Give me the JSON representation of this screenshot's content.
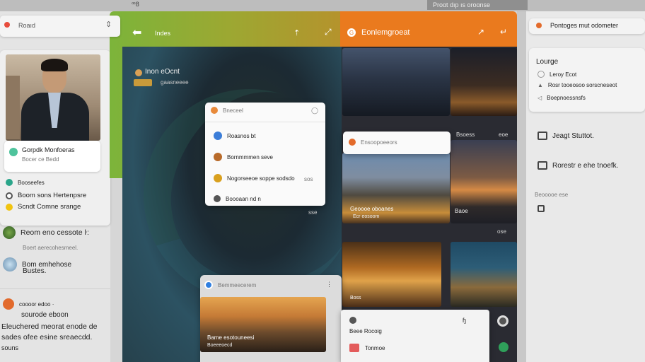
{
  "topbar": {
    "left_text": "ꟹ8",
    "right_text": "Proɑt dıp ıs oroɑnse"
  },
  "search": {
    "placeholder": "Roaıd"
  },
  "profile": {
    "name_line1": "Gorpdk Monfoeras",
    "name_line2": "Bocer ce Bedd",
    "items": [
      "Booseefes",
      "Boom sons Hertenpsre",
      "Scndt Comne srange"
    ]
  },
  "left_list": [
    {
      "title": "Reom eno cessote ŀ:",
      "sub": "Boert aerecohesmeel."
    },
    {
      "title": "Bom emhehose",
      "sub": "Bustes."
    },
    {
      "title": "coooor edoo ·",
      "sub": "sourode eboon"
    }
  ],
  "left_footer": [
    "Eleuchered meorat enode de",
    "sades ofee esine sreaecdd.",
    "souns"
  ],
  "green": {
    "title": "Indes",
    "sub_title": "Inon eOcnt",
    "sub_meta": "gaasneeee"
  },
  "orange": {
    "title": "Eonlemgroeat"
  },
  "popup_center": {
    "header": "Bneceel",
    "items": [
      {
        "label": "Roasnos bt",
        "meta": ""
      },
      {
        "label": "Bornmmmen seve",
        "meta": ""
      },
      {
        "label": "Nogorseeoe soppe sodsdo",
        "meta": "sos"
      },
      {
        "label": "Boooaan nd n",
        "meta": ""
      }
    ],
    "footer": "sse"
  },
  "gallery_popup": {
    "title": "Ensoopoeeors",
    "label1": "Geoooe oboanes",
    "label2": "Ecr eosoom",
    "side1": "Bsoess",
    "side2": "eoe",
    "side3": "Baoe",
    "side4": "ose"
  },
  "bottom_card": {
    "title": "Bemmeecerem",
    "caption": "Bame esotouneesi",
    "caption2": "Boeeeoecd"
  },
  "bottom_right_card": {
    "line1": "Beee Rocoig",
    "line2": "Tonmoe",
    "meta": "ɧ"
  },
  "gallery_bottom_label": "Boss",
  "right_panel": {
    "header": "Pontoges mut odometer",
    "section": "Lourge",
    "items": [
      "Leroy Ecot",
      "Rosr tooeosoo sorscneseot",
      "Boepnoessnsfs"
    ],
    "action1": "Jeagt Stuttot.",
    "action2": "Rorestr e ehe tnoefk.",
    "sub": "Beooooe ese"
  }
}
